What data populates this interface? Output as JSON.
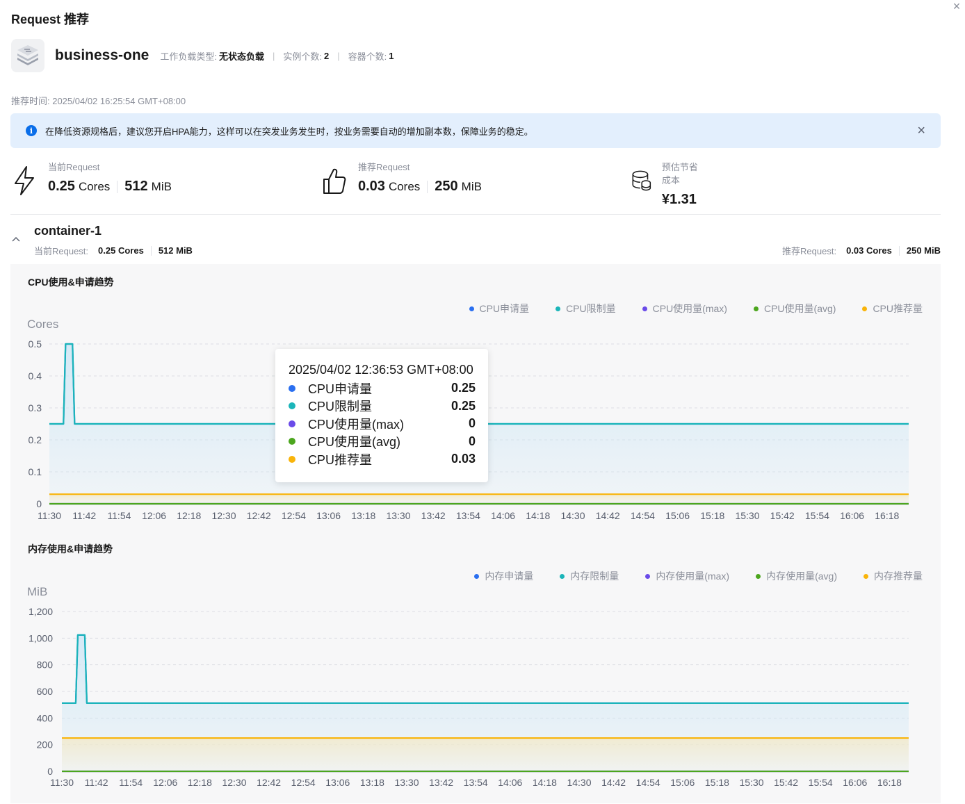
{
  "page": {
    "title": "Request 推荐",
    "close_label": "×"
  },
  "workload": {
    "name": "business-one",
    "type_label": "工作负载类型:",
    "type_value": "无状态负载",
    "instances_label": "实例个数:",
    "instances_value": "2",
    "containers_label": "容器个数:",
    "containers_value": "1",
    "separator": "|"
  },
  "recommend_time": "推荐时间: 2025/04/02 16:25:54 GMT+08:00",
  "notice": {
    "text": "在降低资源规格后，建议您开启HPA能力，这样可以在突发业务发生时，按业务需要自动的增加副本数，保障业务的稳定。",
    "close_label": "×",
    "icon": "info-icon"
  },
  "summary": {
    "current": {
      "label": "当前Request",
      "cpu": "0.25",
      "cpu_unit": "Cores",
      "mem": "512",
      "mem_unit": "MiB",
      "icon": "lightning-icon"
    },
    "recommended": {
      "label": "推荐Request",
      "cpu": "0.03",
      "cpu_unit": "Cores",
      "mem": "250",
      "mem_unit": "MiB",
      "icon": "thumbs-up-icon"
    },
    "saving": {
      "label": "预估节省成本",
      "value": "¥1.31",
      "icon": "coins-database-icon"
    }
  },
  "container": {
    "name": "container-1",
    "current_label": "当前Request:",
    "current_cpu": "0.25 Cores",
    "current_mem": "512 MiB",
    "rec_label": "推荐Request:",
    "rec_cpu": "0.03 Cores",
    "rec_mem": "250 MiB",
    "collapse_icon": "chevron-up-icon"
  },
  "colors": {
    "blue": "#2a6ff0",
    "teal": "#1bb5b9",
    "purple": "#6a4be9",
    "green": "#4ca61e",
    "orange": "#f9b40a",
    "fill_top": "#cfe7f5"
  },
  "tooltip": {
    "title": "2025/04/02 12:36:53 GMT+08:00",
    "rows": [
      {
        "name": "CPU申请量",
        "value": "0.25",
        "color": "#2a6ff0"
      },
      {
        "name": "CPU限制量",
        "value": "0.25",
        "color": "#1bb5b9"
      },
      {
        "name": "CPU使用量(max)",
        "value": "0",
        "color": "#6a4be9"
      },
      {
        "name": "CPU使用量(avg)",
        "value": "0",
        "color": "#4ca61e"
      },
      {
        "name": "CPU推荐量",
        "value": "0.03",
        "color": "#f9b40a"
      }
    ]
  },
  "chart_data": [
    {
      "type": "area",
      "title": "CPU使用&申请趋势",
      "ylabel": "Cores",
      "ylim": [
        0,
        0.5
      ],
      "yticks": [
        "0",
        "0.1",
        "0.2",
        "0.3",
        "0.4",
        "0.5"
      ],
      "ytick_values": [
        0,
        0.1,
        0.2,
        0.3,
        0.4,
        0.5
      ],
      "x": [
        "11:30",
        "11:42",
        "11:54",
        "12:06",
        "12:18",
        "12:30",
        "12:42",
        "12:54",
        "13:06",
        "13:18",
        "13:30",
        "13:42",
        "13:54",
        "14:06",
        "14:18",
        "14:30",
        "14:42",
        "14:54",
        "15:06",
        "15:18",
        "15:30",
        "15:42",
        "15:54",
        "16:06",
        "16:18"
      ],
      "grid": true,
      "legend_position": "top-right",
      "series": [
        {
          "name": "CPU申请量",
          "color": "#2a6ff0",
          "baseline": 0.25,
          "spike_at": "11:37",
          "spike_value": 0.5
        },
        {
          "name": "CPU限制量",
          "color": "#1bb5b9",
          "baseline": 0.25,
          "spike_at": "11:37",
          "spike_value": 0.5
        },
        {
          "name": "CPU使用量(max)",
          "color": "#6a4be9",
          "baseline": 0
        },
        {
          "name": "CPU使用量(avg)",
          "color": "#4ca61e",
          "baseline": 0
        },
        {
          "name": "CPU推荐量",
          "color": "#f9b40a",
          "baseline": 0.03
        }
      ]
    },
    {
      "type": "area",
      "title": "内存使用&申请趋势",
      "ylabel": "MiB",
      "ylim": [
        0,
        1200
      ],
      "yticks": [
        "0",
        "200",
        "400",
        "600",
        "800",
        "1,000",
        "1,200"
      ],
      "ytick_values": [
        0,
        200,
        400,
        600,
        800,
        1000,
        1200
      ],
      "x": [
        "11:30",
        "11:42",
        "11:54",
        "12:06",
        "12:18",
        "12:30",
        "12:42",
        "12:54",
        "13:06",
        "13:18",
        "13:30",
        "13:42",
        "13:54",
        "14:06",
        "14:18",
        "14:30",
        "14:42",
        "14:54",
        "15:06",
        "15:18",
        "15:30",
        "15:42",
        "15:54",
        "16:06",
        "16:18"
      ],
      "grid": true,
      "legend_position": "top-right",
      "series": [
        {
          "name": "内存申请量",
          "color": "#2a6ff0",
          "baseline": 512,
          "spike_at": "11:37",
          "spike_value": 1024
        },
        {
          "name": "内存限制量",
          "color": "#1bb5b9",
          "baseline": 512,
          "spike_at": "11:37",
          "spike_value": 1024
        },
        {
          "name": "内存使用量(max)",
          "color": "#6a4be9",
          "baseline": 0
        },
        {
          "name": "内存使用量(avg)",
          "color": "#4ca61e",
          "baseline": 0
        },
        {
          "name": "内存推荐量",
          "color": "#f9b40a",
          "baseline": 250
        }
      ]
    }
  ]
}
